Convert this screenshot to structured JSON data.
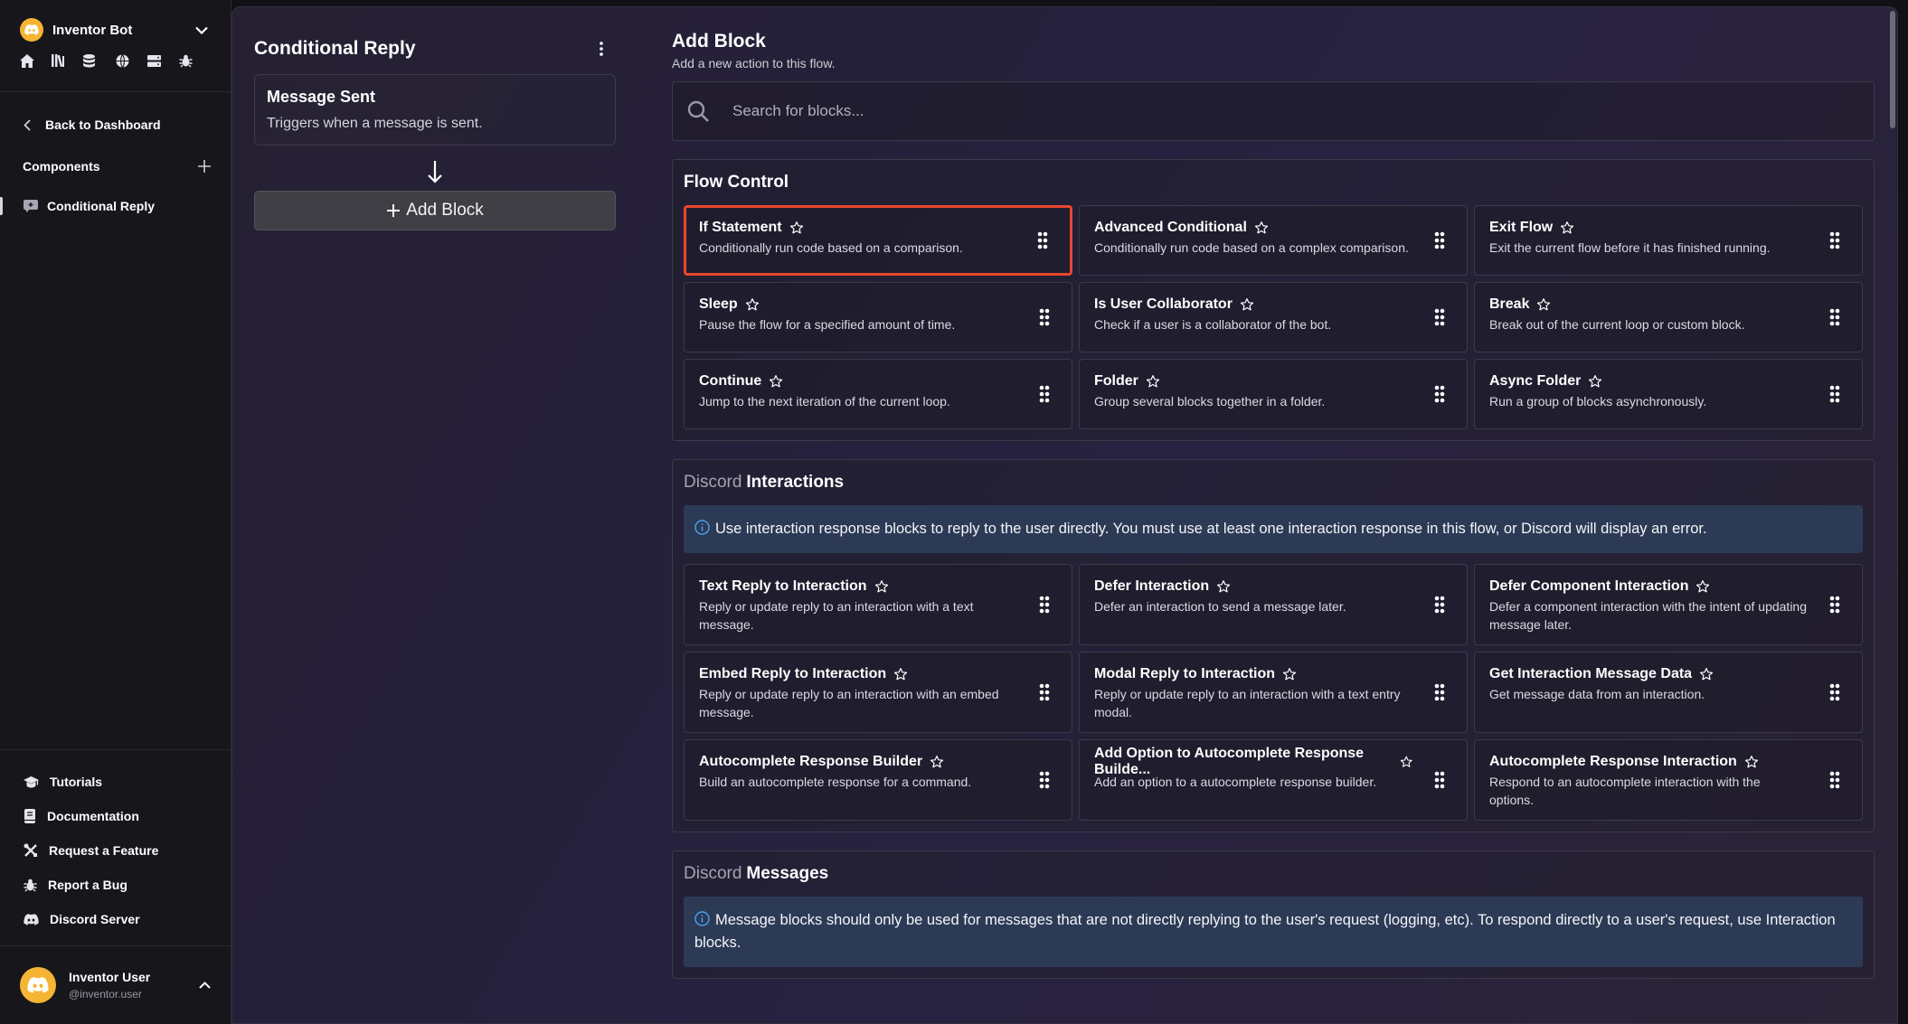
{
  "sidebar": {
    "bot_name": "Inventor Bot",
    "bot_icons": [
      "home-icon",
      "library-icon",
      "database-icon",
      "globe-icon",
      "server-icon",
      "bug-icon"
    ],
    "back_label": "Back to Dashboard",
    "components_label": "Components",
    "active_component": "Conditional Reply",
    "help_items": [
      {
        "label": "Tutorials",
        "icon": "graduation-cap-icon"
      },
      {
        "label": "Documentation",
        "icon": "book-icon"
      },
      {
        "label": "Request a Feature",
        "icon": "tools-icon"
      },
      {
        "label": "Report a Bug",
        "icon": "bug-icon"
      },
      {
        "label": "Discord Server",
        "icon": "discord-icon"
      }
    ],
    "user": {
      "name": "Inventor User",
      "handle": "@inventor.user"
    }
  },
  "flow": {
    "title": "Conditional Reply",
    "trigger_title": "Message Sent",
    "trigger_desc": "Triggers when a message is sent.",
    "add_block_label": "Add Block"
  },
  "blocks": {
    "title": "Add Block",
    "subtitle": "Add a new action to this flow.",
    "search_placeholder": "Search for blocks...",
    "sections": [
      {
        "prefix": "",
        "title": "Flow Control",
        "info": "",
        "items": [
          {
            "title": "If Statement",
            "desc": "Conditionally run code based on a comparison.",
            "selected": true
          },
          {
            "title": "Advanced Conditional",
            "desc": "Conditionally run code based on a complex comparison."
          },
          {
            "title": "Exit Flow",
            "desc": "Exit the current flow before it has finished running."
          },
          {
            "title": "Sleep",
            "desc": "Pause the flow for a specified amount of time."
          },
          {
            "title": "Is User Collaborator",
            "desc": "Check if a user is a collaborator of the bot."
          },
          {
            "title": "Break",
            "desc": "Break out of the current loop or custom block."
          },
          {
            "title": "Continue",
            "desc": "Jump to the next iteration of the current loop."
          },
          {
            "title": "Folder",
            "desc": "Group several blocks together in a folder."
          },
          {
            "title": "Async Folder",
            "desc": "Run a group of blocks asynchronously."
          }
        ]
      },
      {
        "prefix": "Discord",
        "title": "Interactions",
        "info": "Use interaction response blocks to reply to the user directly. You must use at least one interaction response in this flow, or Discord will display an error.",
        "items": [
          {
            "title": "Text Reply to Interaction",
            "desc": "Reply or update reply to an interaction with a text message."
          },
          {
            "title": "Defer Interaction",
            "desc": "Defer an interaction to send a message later."
          },
          {
            "title": "Defer Component Interaction",
            "desc": "Defer a component interaction with the intent of updating message later."
          },
          {
            "title": "Embed Reply to Interaction",
            "desc": "Reply or update reply to an interaction with an embed message."
          },
          {
            "title": "Modal Reply to Interaction",
            "desc": "Reply or update reply to an interaction with a text entry modal."
          },
          {
            "title": "Get Interaction Message Data",
            "desc": "Get message data from an interaction."
          },
          {
            "title": "Autocomplete Response Builder",
            "desc": "Build an autocomplete response for a command."
          },
          {
            "title": "Add Option to Autocomplete Response Builde...",
            "desc": "Add an option to a autocomplete response builder."
          },
          {
            "title": "Autocomplete Response Interaction",
            "desc": "Respond to an autocomplete interaction with the options."
          }
        ]
      },
      {
        "prefix": "Discord",
        "title": "Messages",
        "info": "Message blocks should only be used for messages that are not directly replying to the user's request (logging, etc). To respond directly to a user's request, use Interaction blocks.",
        "items": []
      }
    ]
  },
  "colors": {
    "accent_selected": "#e8472c",
    "avatar": "#f5b433",
    "info_bar": "#2c3a55"
  }
}
